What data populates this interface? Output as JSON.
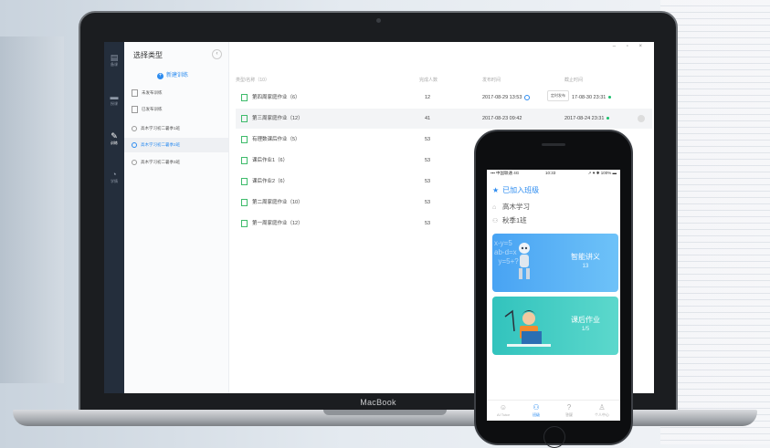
{
  "laptop": {
    "brand": "MacBook",
    "window_controls": "– ▫ ×",
    "rail": [
      {
        "icon": "book-icon",
        "glyph": "▤",
        "label": "备课"
      },
      {
        "icon": "chat-icon",
        "glyph": "▬",
        "label": "授课"
      },
      {
        "icon": "pen-icon",
        "glyph": "✎",
        "label": "训练"
      },
      {
        "icon": "pie-chart-icon",
        "glyph": "◔",
        "label": "学情"
      }
    ],
    "sidebar": {
      "title": "选择类型",
      "collapse": "‹",
      "new_button": "新建训练",
      "items": [
        {
          "label": "未发布训练",
          "kind": "doc"
        },
        {
          "label": "已发布训练",
          "kind": "doc"
        },
        {
          "label": "高木学习初二暑季1班",
          "kind": "class"
        },
        {
          "label": "高木学习初二暑季2班",
          "kind": "class"
        },
        {
          "label": "高木学习初二暑季3班",
          "kind": "class"
        }
      ]
    },
    "table": {
      "headers": [
        "类型/名称（10）",
        "完成人数",
        "发布时间",
        "截止时间"
      ],
      "rows": [
        {
          "name": "第四周家庭作业（6）",
          "count": "12",
          "publish": "2017-08-29 13:53",
          "deadline": "17-08-30 23:31"
        },
        {
          "name": "第三周家庭作业（12）",
          "count": "41",
          "publish": "2017-08-23 09:42",
          "deadline": "2017-08-24 23:31"
        },
        {
          "name": "有理数课后作业（5）",
          "count": "53",
          "publish": "",
          "deadline": ""
        },
        {
          "name": "课后作业1（6）",
          "count": "53",
          "publish": "",
          "deadline": ""
        },
        {
          "name": "课后作业2（6）",
          "count": "53",
          "publish": "",
          "deadline": ""
        },
        {
          "name": "第二周家庭作业（10）",
          "count": "53",
          "publish": "",
          "deadline": ""
        },
        {
          "name": "第一周家庭作业（12）",
          "count": "53",
          "publish": "",
          "deadline": ""
        }
      ],
      "tooltip": "定时发布"
    }
  },
  "phone": {
    "status": {
      "carrier": "▪▪▪ 中国联通 4G",
      "time": "10:33",
      "battery": "↗ ♥ ✱ 100% ▬"
    },
    "joined_label": "已加入班级",
    "school": "高木学习",
    "class_name": "秋季1班",
    "cards": [
      {
        "title": "智能讲义",
        "sub": "13",
        "formula": "x-y=5\nab-d=x\ny=5+?"
      },
      {
        "title": "课后作业",
        "sub": "1/5"
      }
    ],
    "tabs": [
      {
        "icon": "smile-icon",
        "glyph": "☺",
        "label": "AI Tutor"
      },
      {
        "icon": "users-icon",
        "glyph": "⚇",
        "label": "班级"
      },
      {
        "icon": "question-icon",
        "glyph": "?",
        "label": "答疑"
      },
      {
        "icon": "person-icon",
        "glyph": "♙",
        "label": "个人中心"
      }
    ],
    "active_tab": 1
  }
}
